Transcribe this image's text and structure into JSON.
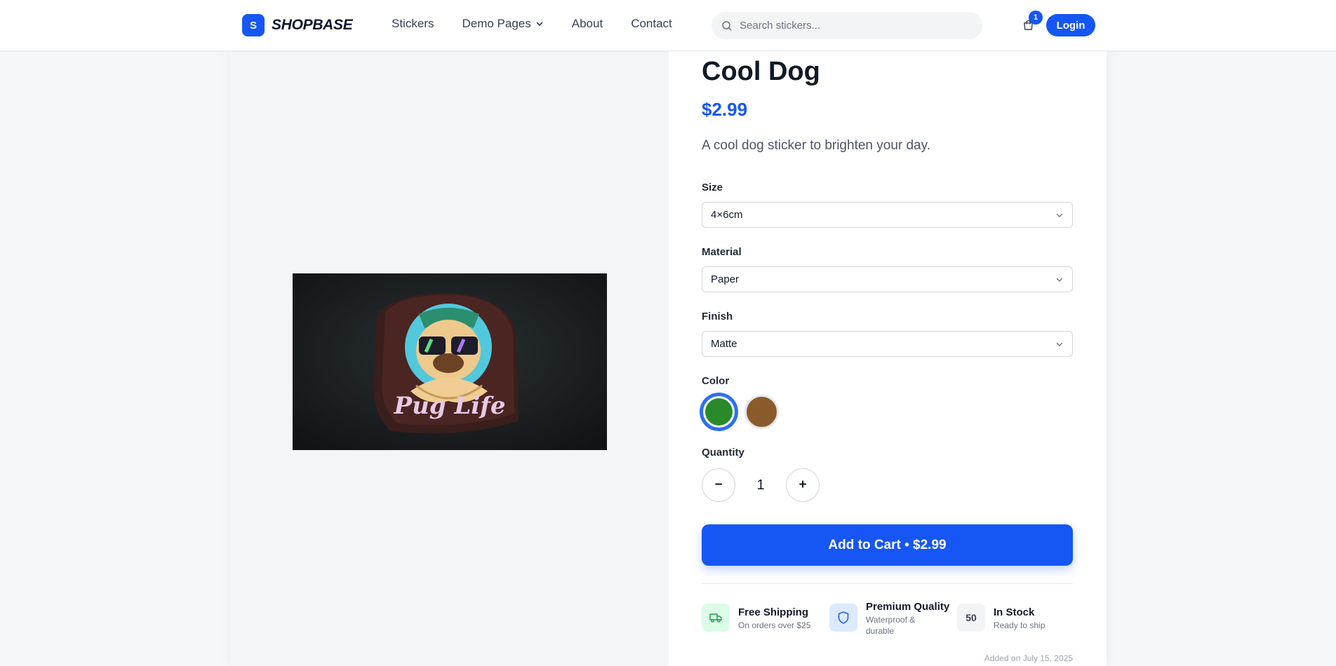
{
  "header": {
    "logo_letter": "S",
    "brand": "SHOPBASE",
    "nav": {
      "stickers": "Stickers",
      "demo_pages": "Demo Pages",
      "about": "About",
      "contact": "Contact"
    },
    "search_placeholder": "Search stickers...",
    "cart_count": "1",
    "login_label": "Login"
  },
  "product": {
    "title": "Cool Dog",
    "price": "$2.99",
    "description": "A cool dog sticker to brighten your day.",
    "image_text": "Pug Life",
    "size_label": "Size",
    "size_value": "4×6cm",
    "material_label": "Material",
    "material_value": "Paper",
    "finish_label": "Finish",
    "finish_value": "Matte",
    "color_label": "Color",
    "colors": [
      "#2a8a2a",
      "#8b5a2b"
    ],
    "selected_color_index": 0,
    "quantity_label": "Quantity",
    "quantity_minus": "−",
    "quantity": "1",
    "quantity_plus": "+",
    "add_to_cart_label": "Add to Cart • $2.99"
  },
  "features": {
    "shipping": {
      "title": "Free Shipping",
      "sub": "On orders over $25"
    },
    "quality": {
      "title": "Premium Quality",
      "sub": "Waterproof & durable"
    },
    "stock": {
      "count": "50",
      "title": "In Stock",
      "sub": "Ready to ship"
    }
  },
  "added_date": "Added on July 15, 2025",
  "colors": {
    "accent": "#1556f5"
  }
}
